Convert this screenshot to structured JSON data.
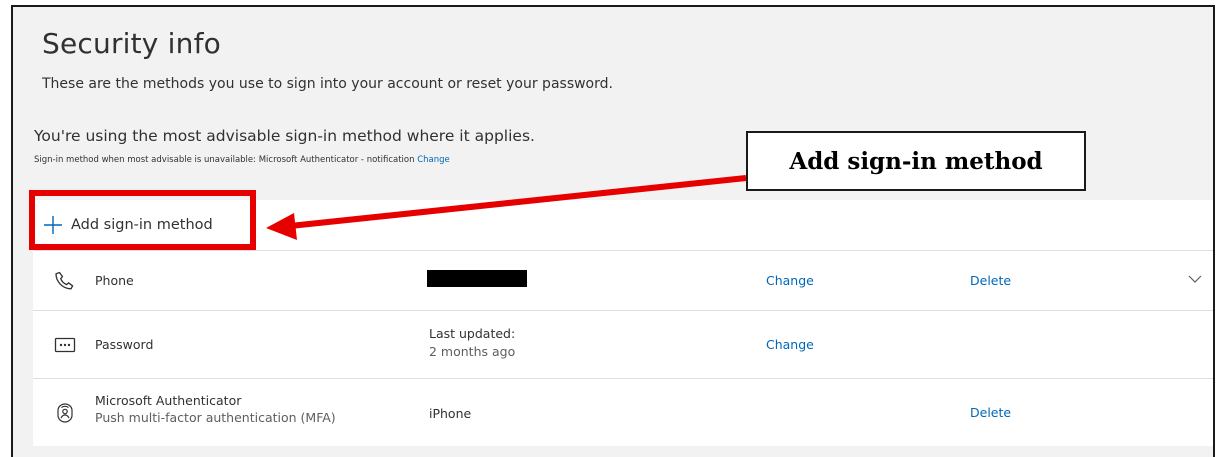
{
  "page": {
    "title": "Security info",
    "subtitle": "These are the methods you use to sign into your account or reset your password.",
    "advisable_text": "You're using the most advisable sign-in method where it applies.",
    "default_method_text": "Sign-in method when most advisable is unavailable: Microsoft Authenticator - notification",
    "default_method_change": "Change"
  },
  "add_method": {
    "label": "Add sign-in method",
    "icon": "plus-icon"
  },
  "methods": [
    {
      "name": "Phone",
      "icon": "phone-icon",
      "detail": "",
      "detail_redacted": true,
      "change_label": "Change",
      "delete_label": "Delete",
      "expand_icon": "chevron-down-icon"
    },
    {
      "name": "Password",
      "icon": "password-icon",
      "detail": "Last updated:",
      "detail_sub": "2 months ago",
      "change_label": "Change"
    },
    {
      "name": "Microsoft Authenticator",
      "name_sub": "Push multi-factor authentication (MFA)",
      "icon": "authenticator-icon",
      "detail": "iPhone",
      "delete_label": "Delete"
    }
  ],
  "annotation": {
    "callout_text": "Add sign-in method",
    "highlight_color": "#e60000",
    "arrow_color": "#e60000"
  },
  "colors": {
    "background": "#f2f2f2",
    "link": "#0067b8",
    "text": "#323130",
    "subtext": "#605e5c"
  }
}
